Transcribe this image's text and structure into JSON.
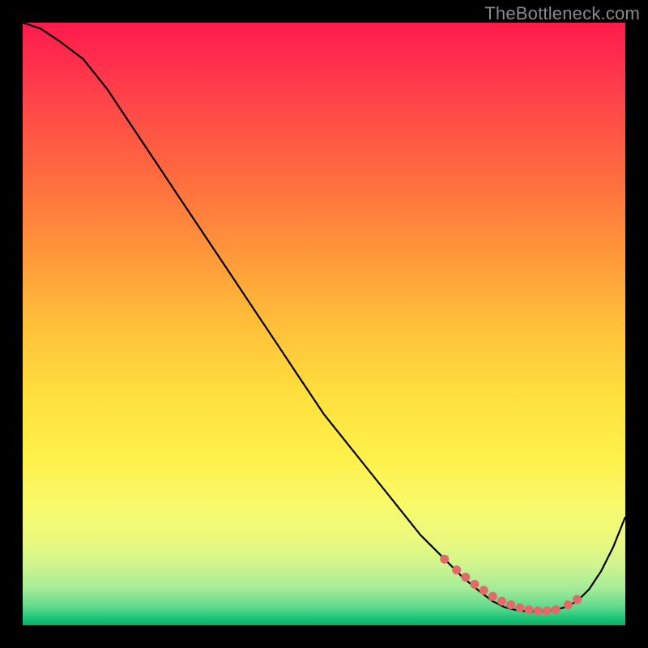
{
  "watermark": "TheBottleneck.com",
  "colors": {
    "background": "#000000",
    "curve": "#000000",
    "marker": "#e46a6a",
    "gradient_top": "#ff1a4d",
    "gradient_mid": "#ffe03e",
    "gradient_bottom": "#0aad66"
  },
  "chart_data": {
    "type": "line",
    "title": "",
    "xlabel": "",
    "ylabel": "",
    "xlim": [
      0,
      100
    ],
    "ylim": [
      0,
      100
    ],
    "series": [
      {
        "name": "bottleneck-curve",
        "x": [
          0,
          3,
          6,
          10,
          14,
          18,
          22,
          26,
          30,
          34,
          38,
          42,
          46,
          50,
          54,
          58,
          62,
          66,
          70,
          73,
          76,
          78,
          80,
          82,
          84,
          86,
          88,
          90,
          92,
          94,
          96,
          98,
          100
        ],
        "y": [
          100,
          99,
          97,
          94,
          89,
          83,
          77,
          71,
          65,
          59,
          53,
          47,
          41,
          35,
          30,
          25,
          20,
          15,
          11,
          8,
          5.5,
          4,
          3,
          2.5,
          2.3,
          2.3,
          2.5,
          3,
          4,
          6,
          9,
          13,
          18
        ]
      }
    ],
    "markers": {
      "name": "highlight-dots",
      "x": [
        70,
        72,
        73.5,
        75,
        76.5,
        78,
        79.5,
        81,
        82.5,
        84,
        85.5,
        87,
        88.5,
        90.5,
        92
      ],
      "y": [
        11,
        9.2,
        8,
        6.8,
        5.8,
        4.8,
        4,
        3.4,
        2.9,
        2.6,
        2.4,
        2.4,
        2.6,
        3.4,
        4.3
      ]
    }
  }
}
